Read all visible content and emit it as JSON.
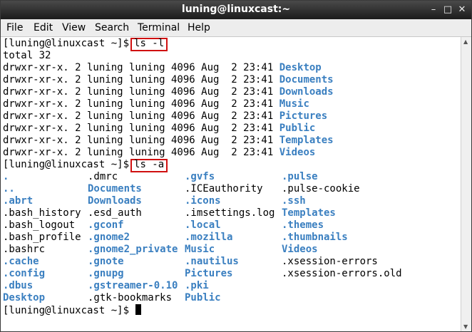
{
  "window": {
    "title": "luning@linuxcast:~",
    "buttons": {
      "minimize": "–",
      "maximize": "□",
      "close": "✕"
    }
  },
  "menu": [
    "File",
    "Edit",
    "View",
    "Search",
    "Terminal",
    "Help"
  ],
  "prompt": "[luning@linuxcast ~]$",
  "commands": {
    "ls_l": "ls -l",
    "ls_a": "ls -a"
  },
  "ls_l": {
    "total": "total 32",
    "rows": [
      {
        "meta": "drwxr-xr-x. 2 luning luning 4096 Aug  2 23:41",
        "name": "Desktop"
      },
      {
        "meta": "drwxr-xr-x. 2 luning luning 4096 Aug  2 23:41",
        "name": "Documents"
      },
      {
        "meta": "drwxr-xr-x. 2 luning luning 4096 Aug  2 23:41",
        "name": "Downloads"
      },
      {
        "meta": "drwxr-xr-x. 2 luning luning 4096 Aug  2 23:41",
        "name": "Music"
      },
      {
        "meta": "drwxr-xr-x. 2 luning luning 4096 Aug  2 23:41",
        "name": "Pictures"
      },
      {
        "meta": "drwxr-xr-x. 2 luning luning 4096 Aug  2 23:41",
        "name": "Public"
      },
      {
        "meta": "drwxr-xr-x. 2 luning luning 4096 Aug  2 23:41",
        "name": "Templates"
      },
      {
        "meta": "drwxr-xr-x. 2 luning luning 4096 Aug  2 23:41",
        "name": "Videos"
      }
    ]
  },
  "ls_a": {
    "rows": [
      [
        {
          "t": ".",
          "d": true
        },
        {
          "t": ".dmrc",
          "d": false
        },
        {
          "t": ".gvfs",
          "d": true
        },
        {
          "t": ".pulse",
          "d": true
        }
      ],
      [
        {
          "t": "..",
          "d": true
        },
        {
          "t": "Documents",
          "d": true
        },
        {
          "t": ".ICEauthority",
          "d": false
        },
        {
          "t": ".pulse-cookie",
          "d": false
        }
      ],
      [
        {
          "t": ".abrt",
          "d": true
        },
        {
          "t": "Downloads",
          "d": true
        },
        {
          "t": ".icons",
          "d": true
        },
        {
          "t": ".ssh",
          "d": true
        }
      ],
      [
        {
          "t": ".bash_history",
          "d": false
        },
        {
          "t": ".esd_auth",
          "d": false
        },
        {
          "t": ".imsettings.log",
          "d": false
        },
        {
          "t": "Templates",
          "d": true
        }
      ],
      [
        {
          "t": ".bash_logout",
          "d": false
        },
        {
          "t": ".gconf",
          "d": true
        },
        {
          "t": ".local",
          "d": true
        },
        {
          "t": ".themes",
          "d": true
        }
      ],
      [
        {
          "t": ".bash_profile",
          "d": false
        },
        {
          "t": ".gnome2",
          "d": true
        },
        {
          "t": ".mozilla",
          "d": true
        },
        {
          "t": ".thumbnails",
          "d": true
        }
      ],
      [
        {
          "t": ".bashrc",
          "d": false
        },
        {
          "t": ".gnome2_private",
          "d": true
        },
        {
          "t": "Music",
          "d": true
        },
        {
          "t": "Videos",
          "d": true
        }
      ],
      [
        {
          "t": ".cache",
          "d": true
        },
        {
          "t": ".gnote",
          "d": true
        },
        {
          "t": ".nautilus",
          "d": true
        },
        {
          "t": ".xsession-errors",
          "d": false
        }
      ],
      [
        {
          "t": ".config",
          "d": true
        },
        {
          "t": ".gnupg",
          "d": true
        },
        {
          "t": "Pictures",
          "d": true
        },
        {
          "t": ".xsession-errors.old",
          "d": false
        }
      ],
      [
        {
          "t": ".dbus",
          "d": true
        },
        {
          "t": ".gstreamer-0.10",
          "d": true
        },
        {
          "t": ".pki",
          "d": true
        },
        null
      ],
      [
        {
          "t": "Desktop",
          "d": true
        },
        {
          "t": ".gtk-bookmarks",
          "d": false
        },
        {
          "t": "Public",
          "d": true
        },
        null
      ]
    ]
  },
  "colors": {
    "directory": "#3a7fc0",
    "highlight_box": "#d01010",
    "titlebar": "#2a2a2a"
  }
}
